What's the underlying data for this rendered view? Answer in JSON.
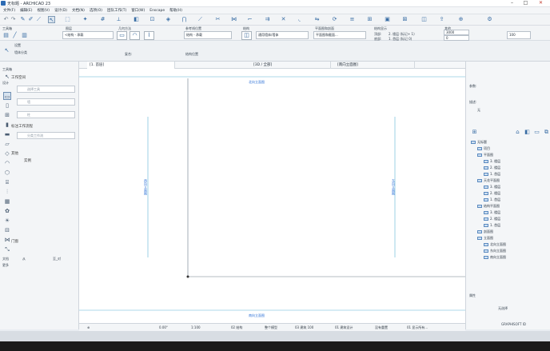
{
  "window": {
    "title": "无标题 - ARCHICAD 23",
    "minimize": "–",
    "maximize": "□",
    "close": "✕"
  },
  "menu": [
    "文件(F)",
    "编辑(E)",
    "视图(V)",
    "设计(D)",
    "文档(N)",
    "选项(O)",
    "团队工作(T)",
    "窗口(W)",
    "Enscape",
    "帮助(H)"
  ],
  "toolbar2": {
    "labels": {
      "tool": "工具箱",
      "floor": "图层",
      "geometry": "几何方法",
      "reference": "参考线位置",
      "structure": "结构",
      "profile": "平面图和剖面",
      "floorplan_show": "结构显示",
      "other": "其他"
    },
    "fields": {
      "layer": "<结构 - 承载",
      "profile_val": "结构 - 承载",
      "floors": "2. 楼层 (标记+ 1)",
      "floors2": "1. 首层 (标记 0)",
      "top_offset": "3000",
      "bottom_offset": "0",
      "rel": "顶部:",
      "rel2": "底部:",
      "height": "100"
    }
  },
  "infobox": {
    "label_a": "设置",
    "label_b": "墙体分类",
    "label_c": "复合:",
    "composite": "通用墙体/墙体",
    "plan_view": "平面图和截面...",
    "section": "结构位置"
  },
  "toolbox": {
    "header": "工具箱",
    "sections": [
      "设计",
      "文档",
      "更多"
    ],
    "items": [
      {
        "label": "工作空间"
      },
      {
        "label": "选择工具",
        "state": "disabled"
      },
      {
        "label": "墙",
        "state": "disabled"
      },
      {
        "label": "柱",
        "state": "disabled"
      },
      {
        "label": "标注工作流程"
      },
      {
        "label": "分类工作流",
        "state": "disabled"
      },
      {
        "label": "其他"
      },
      {
        "label": "实例"
      },
      {
        "label": "门窗"
      }
    ],
    "footer_label": "从",
    "footer_value": "至_对"
  },
  "tabs": [
    {
      "label": "[1. 首层]",
      "active": true
    },
    {
      "label": "[3D / 全部]",
      "active": false
    },
    {
      "label": "[南向立面图]",
      "active": false
    }
  ],
  "canvas": {
    "top_label": "北向立面图",
    "bottom_label": "南向立面图",
    "left_label": "西向立面图",
    "right_label": "东向立面图"
  },
  "status": {
    "zoom": "0.00°",
    "scale": "1:100",
    "floor": "02 结构",
    "model": "整个模型",
    "layers": "03 建筑 100",
    "active": "01 建筑设计",
    "renovation": "没有重置",
    "structure": "01 显示所有..."
  },
  "navigator": {
    "tree": [
      {
        "label": "无标题",
        "level": 0
      },
      {
        "label": "项目",
        "level": 1
      },
      {
        "label": "平面图",
        "level": 1
      },
      {
        "label": "3. 楼层",
        "level": 2
      },
      {
        "label": "2. 楼层",
        "level": 2
      },
      {
        "label": "1. 首层",
        "level": 2
      },
      {
        "label": "天花平面图",
        "level": 1
      },
      {
        "label": "3. 楼层",
        "level": 2
      },
      {
        "label": "2. 楼层",
        "level": 2
      },
      {
        "label": "1. 首层",
        "level": 2
      },
      {
        "label": "结构平面图",
        "level": 1
      },
      {
        "label": "3. 楼层",
        "level": 2
      },
      {
        "label": "2. 楼层",
        "level": 2
      },
      {
        "label": "1. 首层",
        "level": 2
      },
      {
        "label": "剖面图",
        "level": 1
      },
      {
        "label": "立面图",
        "level": 1
      },
      {
        "label": "北向立面图",
        "level": 2
      },
      {
        "label": "东向立面图",
        "level": 2
      },
      {
        "label": "南向立面图",
        "level": 2
      }
    ],
    "properties_header": "属性",
    "properties_empty": "无选择",
    "footer": "GRAPHISOFT ID"
  },
  "panel_top": {
    "label_a": "参数:",
    "label_b": "描述:",
    "label_c": "无"
  }
}
